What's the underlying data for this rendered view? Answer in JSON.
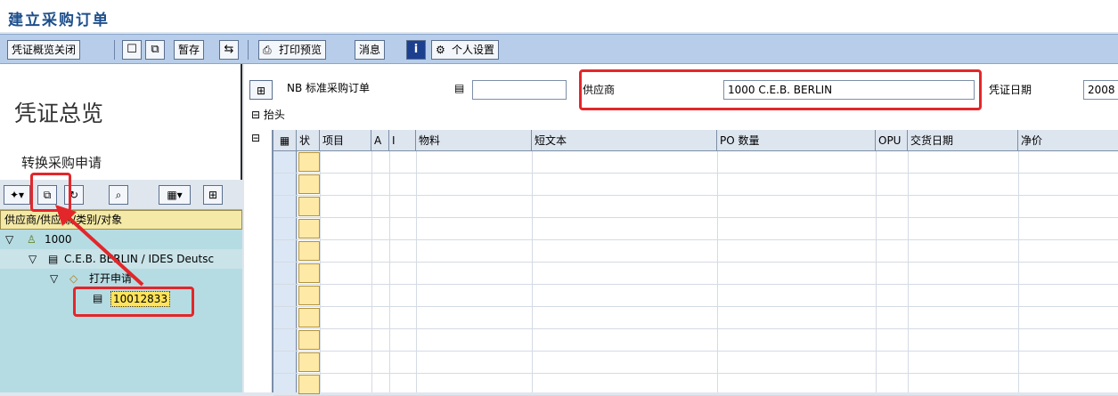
{
  "window": {
    "title": "建立采购订单"
  },
  "toolbar": {
    "doc_overview_close": "凭证概览关闭",
    "save_draft": "暂存",
    "print_preview": "打印预览",
    "messages": "消息",
    "personal_settings": "个人设置"
  },
  "left_panel": {
    "heading": "凭证总览",
    "convert_requisition": "转换采购申请",
    "column_header": "供应商/供应源/类别/对象",
    "tree": [
      {
        "label": "1000",
        "level": 0
      },
      {
        "label": "C.E.B. BERLIN / IDES Deutsc",
        "level": 1
      },
      {
        "label": "打开申请",
        "level": 2
      },
      {
        "label": "10012833",
        "level": 3
      }
    ]
  },
  "header": {
    "doc_type": "NB 标准采购订单",
    "doc_number": "",
    "vendor_label": "供应商",
    "vendor_value": "1000 C.E.B. BERLIN",
    "doc_date_label": "凭证日期",
    "doc_date_value": "2008",
    "section_label": "抬头"
  },
  "items_table": {
    "columns": [
      "状",
      "项目",
      "A",
      "I",
      "物料",
      "短文本",
      "PO 数量",
      "OPU",
      "交货日期",
      "净价"
    ],
    "row_count": 11
  },
  "colors": {
    "accent": "#1d4f8c",
    "highlight": "#e3262a",
    "tree_bg": "#b6dce3",
    "status_cell": "#ffe9a6"
  }
}
